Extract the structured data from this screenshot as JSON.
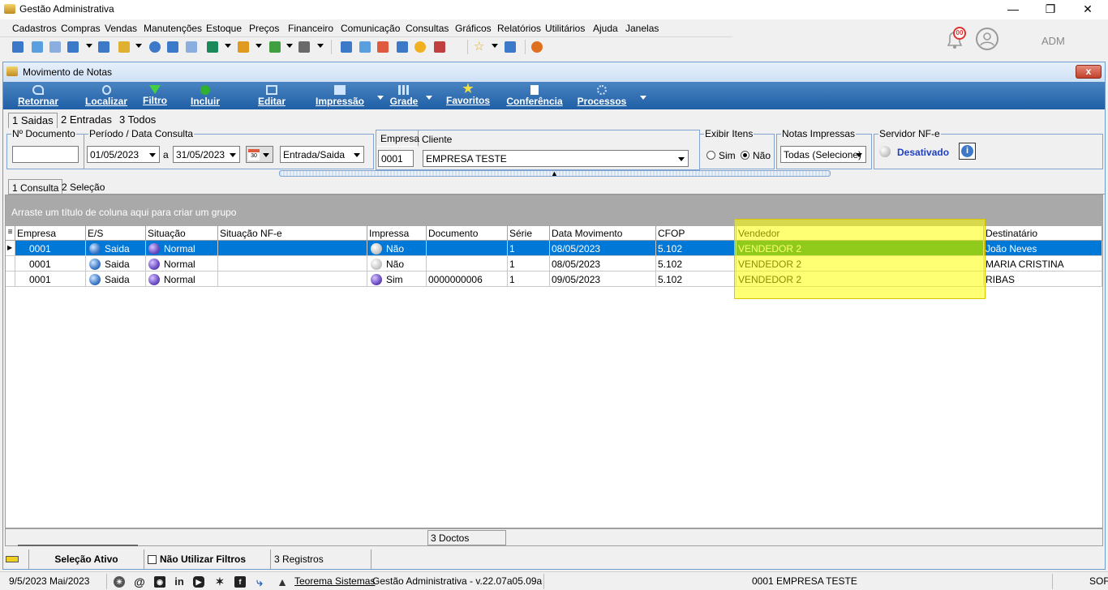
{
  "window": {
    "title": "Gestão Administrativa"
  },
  "menu": [
    "Cadastros",
    "Compras",
    "Vendas",
    "Manutenções",
    "Estoque",
    "Preços",
    "Financeiro",
    "Comunicação",
    "Consultas",
    "Gráficos",
    "Relatórios",
    "Utilitários",
    "Ajuda",
    "Janelas"
  ],
  "notifications": {
    "badge": "00"
  },
  "user": "ADM",
  "child_window": {
    "title": "Movimento de Notas",
    "close": "x"
  },
  "actions": [
    "Retornar",
    "Localizar",
    "Filtro",
    "Incluir",
    "Editar",
    "Impressão",
    "Grade",
    "Favoritos",
    "Conferência",
    "Processos"
  ],
  "tabs": [
    "1 Saidas",
    "2 Entradas",
    "3 Todos"
  ],
  "filters": {
    "documento_label": "Nº Documento",
    "documento_value": "",
    "periodo_label": "Período / Data Consulta",
    "data_inicio": "01/05/2023",
    "separator": "a",
    "data_fim": "31/05/2023",
    "calendar_num": "30",
    "tipo": "Entrada/Saida",
    "empresa_label": "Empresa",
    "empresa_value": "0001",
    "cliente_label": "Cliente",
    "cliente_value": "EMPRESA TESTE",
    "exibir_label": "Exibir Itens",
    "sim": "Sim",
    "nao": "Não",
    "impressas_label": "Notas Impressas",
    "impressas_value": "Todas (Selecione)",
    "servidor_label": "Servidor NF-e",
    "servidor_status": "Desativado",
    "info": "i"
  },
  "subtabs": [
    "1 Consulta",
    "2 Seleção"
  ],
  "grid": {
    "group_hint": "Arraste um título de coluna aqui para criar um grupo",
    "columns": [
      "Empresa",
      "E/S",
      "Situação",
      "Situação NF-e",
      "Impressa",
      "Documento",
      "Série",
      "Data Movimento",
      "CFOP",
      "Vendedor",
      "Destinatário"
    ],
    "rows": [
      [
        "0001",
        "Saida",
        "Normal",
        "",
        "Não",
        "",
        "1",
        "08/05/2023",
        "5.102",
        "VENDEDOR 2",
        "João Neves"
      ],
      [
        "0001",
        "Saida",
        "Normal",
        "",
        "Não",
        "",
        "1",
        "08/05/2023",
        "5.102",
        "VENDEDOR 2",
        "MARIA CRISTINA"
      ],
      [
        "0001",
        "Saida",
        "Normal",
        "",
        "Sim",
        "0000000006",
        "1",
        "09/05/2023",
        "5.102",
        "VENDEDOR 2",
        "RIBAS"
      ]
    ],
    "count": "3 Doctos"
  },
  "statusbar": {
    "selecao": "Seleção Ativo",
    "nao_utilizar": "Não Utilizar Filtros",
    "registros": "3 Registros",
    "date": "9/5/2023 Mai/2023",
    "company_link": "Teorema Sistemas",
    "version": "Gestão Administrativa - v.22.07a05.09a",
    "empresa": "0001 EMPRESA TESTE",
    "right": "SOF"
  }
}
